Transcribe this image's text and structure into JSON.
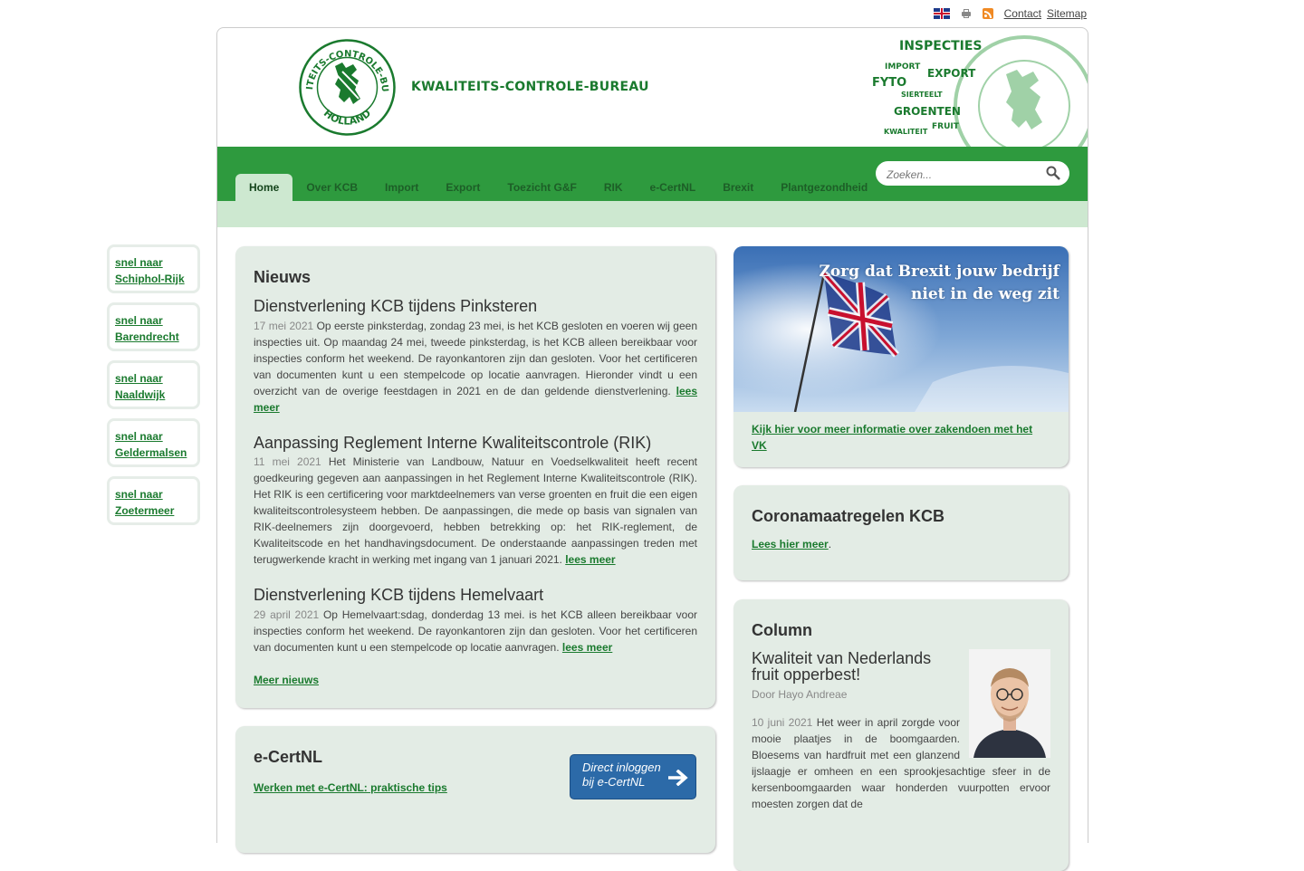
{
  "topbar": {
    "contact": "Contact",
    "sitemap": "Sitemap"
  },
  "header": {
    "brand": "KWALITEITS-CONTROLE-BUREAU",
    "seal_text_top": "KWALITEITS-CONTROLE-BUREAU",
    "seal_text_bottom": "HOLLAND",
    "tags": {
      "inspecties": "INSPECTIES",
      "import": "IMPORT",
      "export": "EXPORT",
      "fyto": "FYTO",
      "sierteelt": "SIERTEELT",
      "groenten": "GROENTEN",
      "kwaliteit": "KWALITEIT",
      "fruit": "FRUIT"
    }
  },
  "nav": {
    "items": [
      "Home",
      "Over KCB",
      "Import",
      "Export",
      "Toezicht G&F",
      "RIK",
      "e-CertNL",
      "Brexit",
      "Plantgezondheid"
    ]
  },
  "search": {
    "placeholder": "Zoeken..."
  },
  "quicklinks": [
    {
      "line1": "snel naar",
      "line2": "Schiphol-Rijk"
    },
    {
      "line1": "snel naar",
      "line2": "Barendrecht"
    },
    {
      "line1": "snel naar",
      "line2": "Naaldwijk"
    },
    {
      "line1": "snel naar",
      "line2": "Geldermalsen"
    },
    {
      "line1": "snel naar",
      "line2": "Zoetermeer"
    }
  ],
  "news": {
    "heading": "Nieuws",
    "items": [
      {
        "title": "Dienstverlening KCB tijdens Pinksteren",
        "date": "17 mei 2021",
        "text": "Op eerste pinksterdag, zondag 23 mei, is het KCB gesloten en voeren wij geen inspecties uit. Op maandag 24 mei, tweede pinksterdag, is het KCB alleen bereikbaar voor inspecties conform het weekend. De rayonkantoren zijn dan gesloten. Voor het certificeren van documenten kunt u een stempelcode op locatie aanvragen. Hieronder vindt u een overzicht van de overige feestdagen in 2021 en de dan geldende dienstverlening.",
        "more": "lees meer"
      },
      {
        "title": "Aanpassing Reglement Interne Kwaliteitscontrole (RIK)",
        "date": "11 mei 2021",
        "text": "Het Ministerie van Landbouw, Natuur en Voedselkwaliteit heeft recent goedkeuring gegeven aan aanpassingen in het Reglement Interne Kwaliteitscontrole (RIK). Het RIK is een certificering voor marktdeelnemers van verse groenten en fruit die een eigen kwaliteitscontrolesysteem hebben. De aanpassingen, die mede op basis van signalen van RIK-deelnemers zijn doorgevoerd, hebben betrekking op: het RIK-reglement, de Kwaliteitscode en het handhavingsdocument. De onderstaande aanpassingen treden met terugwerkende kracht in werking met ingang van 1 januari 2021.",
        "more": "lees meer"
      },
      {
        "title": "Dienstverlening KCB tijdens Hemelvaart",
        "date": "29 april 2021",
        "text": "Op Hemelvaart:sdag, donderdag 13 mei. is het KCB alleen bereikbaar voor inspecties conform het weekend. De rayonkantoren zijn dan gesloten. Voor het certificeren van documenten kunt u een stempelcode op locatie aanvragen.",
        "more": "lees meer"
      }
    ],
    "all_link": "Meer nieuws"
  },
  "ecert": {
    "heading": "e-CertNL",
    "link": "Werken met e-CertNL: praktische tips",
    "button_line1": "Direct inloggen",
    "button_line2": "bij e-CertNL"
  },
  "brexit": {
    "banner_line1": "Zorg dat Brexit jouw bedrijf",
    "banner_line2": "niet in de weg zit",
    "link": "Kijk hier voor meer informatie over zakendoen met het VK"
  },
  "corona": {
    "heading": "Coronamaatregelen KCB",
    "link": "Lees hier meer",
    "suffix": "."
  },
  "column": {
    "heading": "Column",
    "title": "Kwaliteit van Nederlands fruit opperbest!",
    "author": "Door Hayo Andreae",
    "date": "10 juni 2021",
    "text": "Het weer in april zorgde voor mooie plaatjes in de boomgaarden. Bloesems van hardfruit met een glanzend ijslaagje er omheen en een sprookjesachtige sfeer in de kersenboomgaarden waar honderden vuurpotten ervoor moesten zorgen dat de"
  },
  "colors": {
    "brand_green": "#1a7a2e",
    "nav_green": "#2e9a3e",
    "nav_light": "#cde8d0",
    "panel_bg": "#e3ece5",
    "link_green": "#1a7a2e"
  }
}
